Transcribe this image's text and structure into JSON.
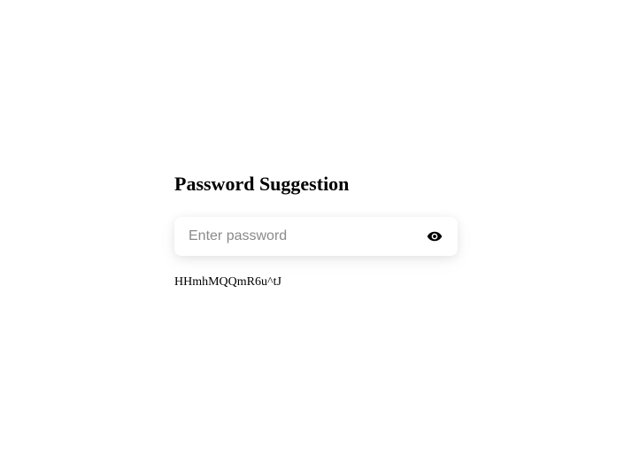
{
  "heading": "Password Suggestion",
  "input": {
    "placeholder": "Enter password",
    "value": ""
  },
  "suggestion": "HHmhMQQmR6u^tJ"
}
